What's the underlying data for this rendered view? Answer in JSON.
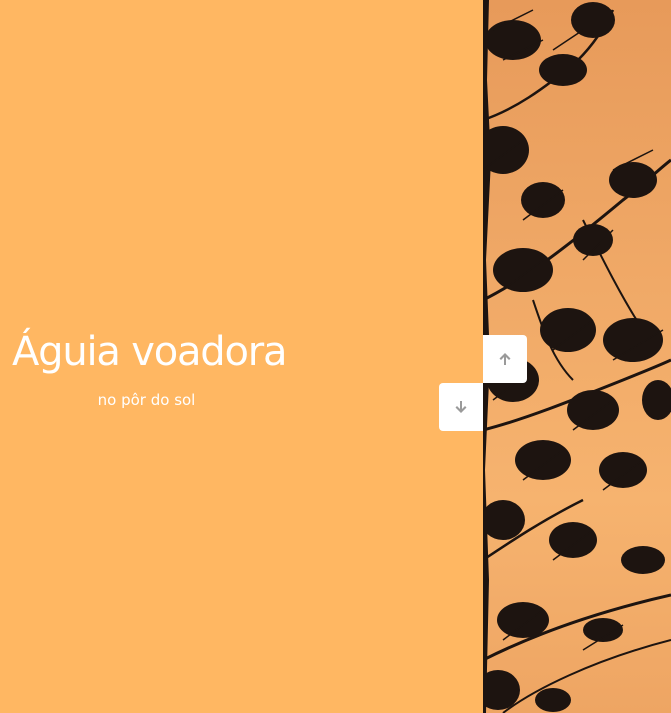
{
  "slide": {
    "title": "Águia voadora",
    "subtitle": "no pôr do sol"
  },
  "controls": {
    "up_icon": "arrow-up-icon",
    "down_icon": "arrow-down-icon"
  },
  "colors": {
    "left_background": "#ffb762",
    "text": "#ffffff",
    "button_background": "#ffffff",
    "button_icon": "#9a9a9a",
    "tree_silhouette": "#1d1410"
  }
}
